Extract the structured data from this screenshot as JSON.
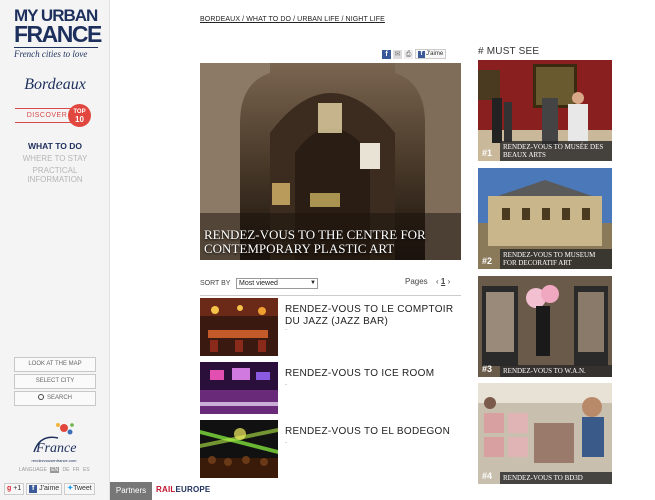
{
  "brand": {
    "line1": "MY URBAN",
    "line2": "FRANCE",
    "tagline": "French cities to love"
  },
  "city": "Bordeaux",
  "discover": {
    "label": "DISCOVER",
    "badge_line1": "TOP",
    "badge_line2": "10"
  },
  "nav": {
    "items": [
      {
        "label": "WHAT TO DO",
        "active": true
      },
      {
        "label": "WHERE TO STAY",
        "active": false
      },
      {
        "label": "PRACTICAL INFORMATION",
        "active": false
      }
    ]
  },
  "side_buttons": {
    "map": "LOOK AT THE MAP",
    "city": "SELECT CITY",
    "search": "SEARCH"
  },
  "footer_logo_text": "rendezvousenfrance.com",
  "language": {
    "label": "LANGUAGE",
    "options": [
      "EN",
      "DE",
      "FR",
      "ES"
    ],
    "selected": "EN"
  },
  "social": {
    "gplus": "+1",
    "like": "J'aime",
    "tweet": "Tweet"
  },
  "partners": {
    "label": "Partners",
    "rail_part1": "RAIL",
    "rail_part2": "EUROPE"
  },
  "breadcrumb": "BORDEAUX / WHAT TO DO / URBAN LIFE / NIGHT LIFE",
  "share": {
    "jaime": "J'aime"
  },
  "hero": {
    "title": "RENDEZ-VOUS TO THE CENTRE FOR CONTEMPORARY PLASTIC ART"
  },
  "sort": {
    "label": "SORT BY",
    "selected": "Most viewed",
    "pages_label": "Pages",
    "current_page": "1"
  },
  "list": [
    {
      "title": "RENDEZ-VOUS TO LE COMPTOIR DU JAZZ (JAZZ BAR)",
      "meta": "-"
    },
    {
      "title": "RENDEZ-VOUS TO ICE ROOM",
      "meta": "-"
    },
    {
      "title": "RENDEZ-VOUS TO EL BODEGON",
      "meta": "-"
    }
  ],
  "must_see": {
    "heading": "# MUST SEE",
    "items": [
      {
        "rank": "#1",
        "title": "RENDEZ-VOUS TO MUSÉE DES BEAUX ARTS"
      },
      {
        "rank": "#2",
        "title": "RENDEZ-VOUS TO MUSEUM FOR DECORATIF ART"
      },
      {
        "rank": "#3",
        "title": "RENDEZ-VOUS TO W.A.N."
      },
      {
        "rank": "#4",
        "title": "RENDEZ-VOUS TO BD3D"
      }
    ]
  },
  "colors": {
    "brand_navy": "#1d2f5c",
    "accent_red": "#e2473f",
    "facebook": "#3b5998"
  }
}
